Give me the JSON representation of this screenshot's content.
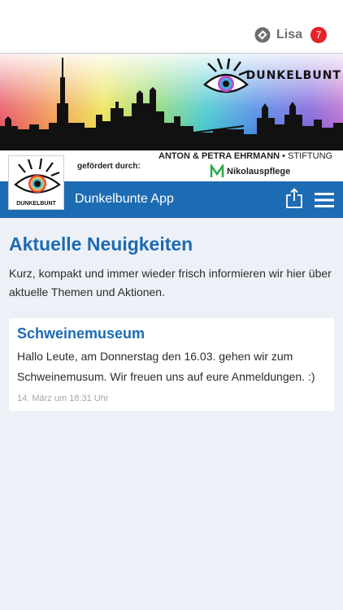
{
  "header": {
    "user_name": "Lisa",
    "notification_count": "7",
    "user_icon": "account-switch-icon",
    "badge_color": "#e2232b"
  },
  "banner": {
    "title": "DUNKELBUNT",
    "logo_icon": "rainbow-eye-logo"
  },
  "sponsor": {
    "label": "gefördert durch:",
    "foundation_name": "ANTON & PETRA EHRMANN",
    "foundation_separator": " • ",
    "foundation_suffix": "STIFTUNG",
    "partner": "Nikolauspflege",
    "partner_icon": "nikolauspflege-logo"
  },
  "app_logo": {
    "text": "DUNKELBUNT"
  },
  "nav": {
    "title": "Dunkelbunte App",
    "share_icon": "share-icon",
    "menu_icon": "hamburger-menu-icon",
    "accent": "#1d6bb3"
  },
  "main": {
    "heading": "Aktuelle Neuigkeiten",
    "intro": "Kurz, kompakt und immer wieder frisch informieren wir hier über aktuelle Themen und Aktionen.",
    "news": [
      {
        "title": "Schweinemuseum",
        "body": "Hallo Leute, am Donnerstag den 16.03. gehen wir zum Schweinemusum. Wir freuen uns auf eure Anmeldungen. :)",
        "date": "14. März um 18:31 Uhr"
      }
    ]
  }
}
